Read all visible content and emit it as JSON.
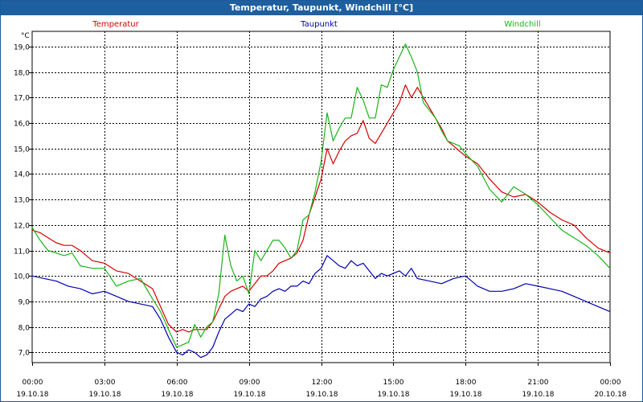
{
  "window": {
    "title": "Temperatur, Taupunkt, Windchill [°C]"
  },
  "colors": {
    "temperature": "#d40000",
    "dewpoint": "#0000b4",
    "windchill": "#18b418",
    "grid": "#000000",
    "titlebar": "#1f5f9f"
  },
  "chart_data": {
    "type": "line",
    "title": "Temperatur, Taupunkt, Windchill [°C]",
    "unit": "°C",
    "ylim": [
      6.6,
      19.6
    ],
    "y_ticks": [
      "19,0",
      "18,0",
      "17,0",
      "16,0",
      "15,0",
      "14,0",
      "13,0",
      "12,0",
      "11,0",
      "10,0",
      "9,0",
      "8,0",
      "7,0"
    ],
    "x_ticks": [
      {
        "time": "00:00",
        "date": "19.10.18"
      },
      {
        "time": "03:00",
        "date": "19.10.18"
      },
      {
        "time": "06:00",
        "date": "19.10.18"
      },
      {
        "time": "09:00",
        "date": "19.10.18"
      },
      {
        "time": "12:00",
        "date": "19.10.18"
      },
      {
        "time": "15:00",
        "date": "19.10.18"
      },
      {
        "time": "18:00",
        "date": "19.10.18"
      },
      {
        "time": "21:00",
        "date": "19.10.18"
      },
      {
        "time": "00:00",
        "date": "20.10.18"
      }
    ],
    "grid": true,
    "legend_position": "top",
    "series": [
      {
        "name": "Temperatur",
        "color": "#d40000",
        "x": [
          0,
          0.33,
          0.66,
          1,
          1.33,
          1.66,
          2,
          2.5,
          3,
          3.5,
          4,
          4.5,
          5,
          5.33,
          5.66,
          6,
          6.25,
          6.5,
          6.75,
          7,
          7.25,
          7.5,
          7.75,
          8,
          8.25,
          8.5,
          8.75,
          9,
          9.25,
          9.5,
          9.75,
          10,
          10.25,
          10.5,
          10.75,
          11,
          11.25,
          11.5,
          11.75,
          12,
          12.25,
          12.5,
          12.75,
          13,
          13.25,
          13.5,
          13.75,
          14,
          14.25,
          14.5,
          14.75,
          15,
          15.25,
          15.5,
          15.75,
          16,
          16.25,
          16.5,
          16.75,
          17,
          17.25,
          17.5,
          17.75,
          18,
          18.5,
          19,
          19.5,
          20,
          20.5,
          21,
          21.5,
          22,
          22.5,
          23,
          23.5,
          24
        ],
        "values": [
          11.8,
          11.7,
          11.5,
          11.3,
          11.2,
          11.2,
          11.0,
          10.6,
          10.5,
          10.2,
          10.1,
          9.8,
          9.5,
          8.8,
          8.1,
          7.8,
          7.9,
          7.8,
          7.9,
          7.9,
          7.9,
          8.2,
          8.7,
          9.2,
          9.4,
          9.5,
          9.6,
          9.4,
          9.7,
          10.0,
          10.0,
          10.2,
          10.5,
          10.6,
          10.7,
          10.9,
          11.4,
          12.4,
          13.1,
          13.8,
          15.0,
          14.4,
          14.9,
          15.3,
          15.5,
          15.6,
          16.1,
          15.4,
          15.2,
          15.6,
          16.0,
          16.4,
          16.8,
          17.5,
          17.0,
          17.4,
          17.0,
          16.6,
          16.2,
          15.8,
          15.3,
          15.1,
          14.9,
          14.7,
          14.4,
          13.8,
          13.3,
          13.1,
          13.2,
          12.9,
          12.5,
          12.2,
          12.0,
          11.5,
          11.1,
          10.9
        ]
      },
      {
        "name": "Taupunkt",
        "color": "#0000b4",
        "x": [
          0,
          0.5,
          1,
          1.5,
          2,
          2.5,
          3,
          3.5,
          4,
          4.5,
          5,
          5.33,
          5.66,
          6,
          6.25,
          6.5,
          6.75,
          7,
          7.25,
          7.5,
          7.75,
          8,
          8.25,
          8.5,
          8.75,
          9,
          9.25,
          9.5,
          9.75,
          10,
          10.25,
          10.5,
          10.75,
          11,
          11.25,
          11.5,
          11.75,
          12,
          12.25,
          12.5,
          12.75,
          13,
          13.25,
          13.5,
          13.75,
          14,
          14.25,
          14.5,
          14.75,
          15,
          15.25,
          15.5,
          15.75,
          16,
          16.5,
          17,
          17.5,
          18,
          18.5,
          19,
          19.5,
          20,
          20.5,
          21,
          21.5,
          22,
          22.5,
          23,
          23.5,
          24
        ],
        "values": [
          10.0,
          9.9,
          9.8,
          9.6,
          9.5,
          9.3,
          9.4,
          9.2,
          9.0,
          8.9,
          8.8,
          8.3,
          7.6,
          7.0,
          6.9,
          7.1,
          7.0,
          6.8,
          6.9,
          7.2,
          7.8,
          8.3,
          8.5,
          8.7,
          8.6,
          8.9,
          8.8,
          9.1,
          9.2,
          9.4,
          9.5,
          9.4,
          9.6,
          9.6,
          9.8,
          9.7,
          10.1,
          10.3,
          10.8,
          10.6,
          10.4,
          10.3,
          10.6,
          10.4,
          10.5,
          10.2,
          9.9,
          10.1,
          10.0,
          10.1,
          10.2,
          10.0,
          10.3,
          9.9,
          9.8,
          9.7,
          9.9,
          10.0,
          9.6,
          9.4,
          9.4,
          9.5,
          9.7,
          9.6,
          9.5,
          9.4,
          9.2,
          9.0,
          8.8,
          8.6
        ]
      },
      {
        "name": "Windchill",
        "color": "#18b418",
        "x": [
          0,
          0.33,
          0.66,
          1,
          1.33,
          1.66,
          2,
          2.5,
          3,
          3.5,
          4,
          4.5,
          5,
          5.33,
          5.66,
          6,
          6.25,
          6.5,
          6.75,
          7,
          7.25,
          7.5,
          7.75,
          8,
          8.25,
          8.5,
          8.75,
          9,
          9.25,
          9.5,
          9.75,
          10,
          10.25,
          10.5,
          10.75,
          11,
          11.25,
          11.5,
          11.75,
          12,
          12.25,
          12.5,
          12.75,
          13,
          13.25,
          13.5,
          13.75,
          14,
          14.25,
          14.5,
          14.75,
          15,
          15.25,
          15.5,
          15.75,
          16,
          16.25,
          16.5,
          16.75,
          17,
          17.25,
          17.5,
          17.75,
          18,
          18.5,
          19,
          19.5,
          20,
          20.5,
          21,
          21.5,
          22,
          22.5,
          23,
          23.5,
          24
        ],
        "values": [
          11.9,
          11.4,
          11.0,
          10.9,
          10.8,
          10.9,
          10.4,
          10.3,
          10.3,
          9.6,
          9.8,
          9.9,
          9.1,
          8.6,
          7.9,
          7.2,
          7.3,
          7.4,
          8.1,
          7.6,
          8.0,
          8.2,
          9.3,
          11.6,
          10.4,
          9.8,
          10.0,
          9.3,
          11.0,
          10.6,
          11.0,
          11.4,
          11.4,
          11.1,
          10.7,
          11.0,
          12.2,
          12.4,
          13.3,
          14.5,
          16.4,
          15.3,
          15.8,
          16.2,
          16.2,
          17.4,
          16.9,
          16.2,
          16.2,
          17.5,
          17.4,
          18.1,
          18.6,
          19.1,
          18.6,
          18.0,
          16.8,
          16.5,
          16.2,
          15.7,
          15.3,
          15.2,
          15.1,
          14.8,
          14.3,
          13.4,
          12.9,
          13.5,
          13.2,
          12.8,
          12.3,
          11.8,
          11.5,
          11.2,
          10.8,
          10.3
        ]
      }
    ]
  }
}
